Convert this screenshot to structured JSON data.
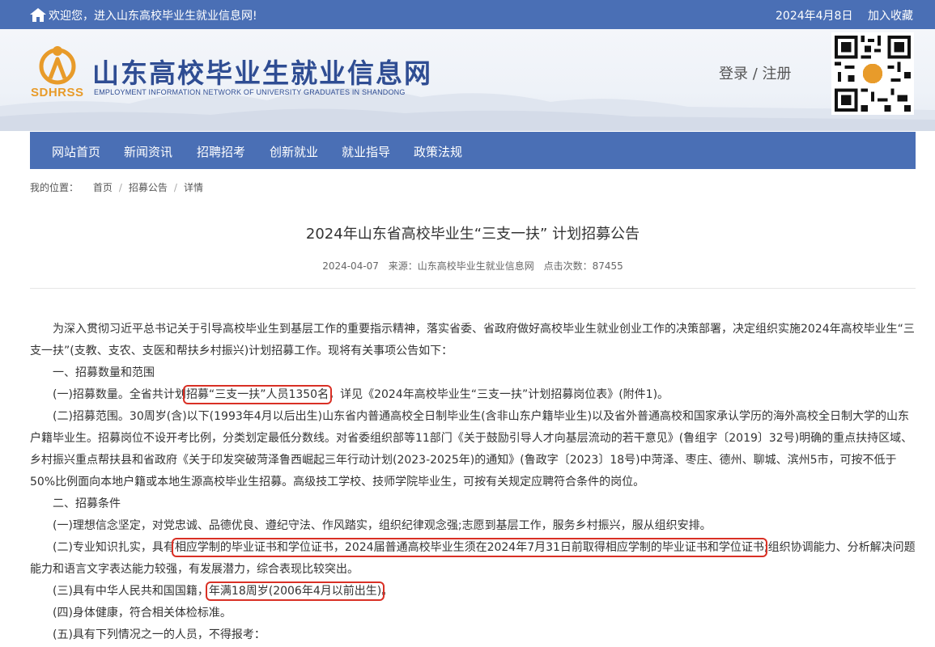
{
  "topbar": {
    "welcome": "欢迎您，进入山东高校毕业生就业信息网!",
    "date": "2024年4月8日",
    "favorite": "加入收藏"
  },
  "header": {
    "logo_abbr": "SDHRSS",
    "title": "山东高校毕业生就业信息网",
    "subtitle": "EMPLOYMENT INFORMATION NETWORK OF UNIVERSITY GRADUATES IN SHANDONG",
    "login": "登录",
    "auth_sep": " / ",
    "register": "注册"
  },
  "nav": {
    "items": [
      "网站首页",
      "新闻资讯",
      "招聘招考",
      "创新就业",
      "就业指导",
      "政策法规"
    ]
  },
  "breadcrumb": {
    "label": "我的位置：",
    "items": [
      "首页",
      "招募公告",
      "详情"
    ],
    "separator": "/"
  },
  "article": {
    "title": "2024年山东省高校毕业生“三支一扶” 计划招募公告",
    "date": "2024-04-07",
    "source": "来源：山东高校毕业生就业信息网",
    "views": "点击次数：87455",
    "p_intro": "　　为深入贯彻习近平总书记关于引导高校毕业生到基层工作的重要指示精神，落实省委、省政府做好高校毕业生就业创业工作的决策部署，决定组织实施2024年高校毕业生“三支一扶”(支教、支农、支医和帮扶乡村振兴)计划招募工作。现将有关事项公告如下：",
    "h1": "　　一、招募数量和范围",
    "p1_pre": "　　(一)招募数量。全省共计划",
    "p1_hl": "招募“三支一扶”人员1350名",
    "p1_post": "，详见《2024年高校毕业生“三支一扶”计划招募岗位表》(附件1)。",
    "p2": "　　(二)招募范围。30周岁(含)以下(1993年4月以后出生)山东省内普通高校全日制毕业生(含非山东户籍毕业生)以及省外普通高校和国家承认学历的海外高校全日制大学的山东户籍毕业生。招募岗位不设开考比例，分类划定最低分数线。对省委组织部等11部门《关于鼓励引导人才向基层流动的若干意见》(鲁组字〔2019〕32号)明确的重点扶持区域、乡村振兴重点帮扶县和省政府《关于印发突破菏泽鲁西崛起三年行动计划(2023-2025年)的通知》(鲁政字〔2023〕18号)中菏泽、枣庄、德州、聊城、滨州5市，可按不低于50%比例面向本地户籍或本地生源高校毕业生招募。高级技工学校、技师学院毕业生，可按有关规定应聘符合条件的岗位。",
    "h2": "　　二、招募条件",
    "c1": "　　(一)理想信念坚定，对党忠诚、品德优良、遵纪守法、作风踏实，组织纪律观念强;志愿到基层工作，服务乡村振兴，服从组织安排。",
    "c2_pre": "　　(二)专业知识扎实，具有",
    "c2_hl": "相应学制的毕业证书和学位证书，2024届普通高校毕业生须在2024年7月31日前取得相应学制的毕业证书和学位证书",
    "c2_post": ";组织协调能力、分析解决问题能力和语言文字表达能力较强，有发展潜力，综合表现比较突出。",
    "c3_pre": "　　(三)具有中华人民共和国国籍，",
    "c3_hl": "年满18周岁(2006年4月以前出生)",
    "c3_post": "。",
    "c4": "　　(四)身体健康，符合相关体检标准。",
    "c5": "　　(五)具有下列情况之一的人员，不得报考："
  }
}
